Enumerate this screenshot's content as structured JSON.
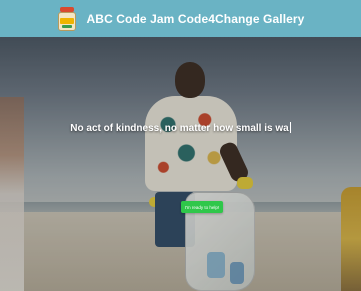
{
  "header": {
    "logo_icon": "jar-logo-icon",
    "title": "ABC Code Jam Code4Change Gallery",
    "background_color": "#6ab3c4"
  },
  "hero": {
    "headline": "No act of kindness, no matter how small is wa",
    "cta_label": "I'm ready to help!",
    "cta_color": "#2fc74a"
  }
}
